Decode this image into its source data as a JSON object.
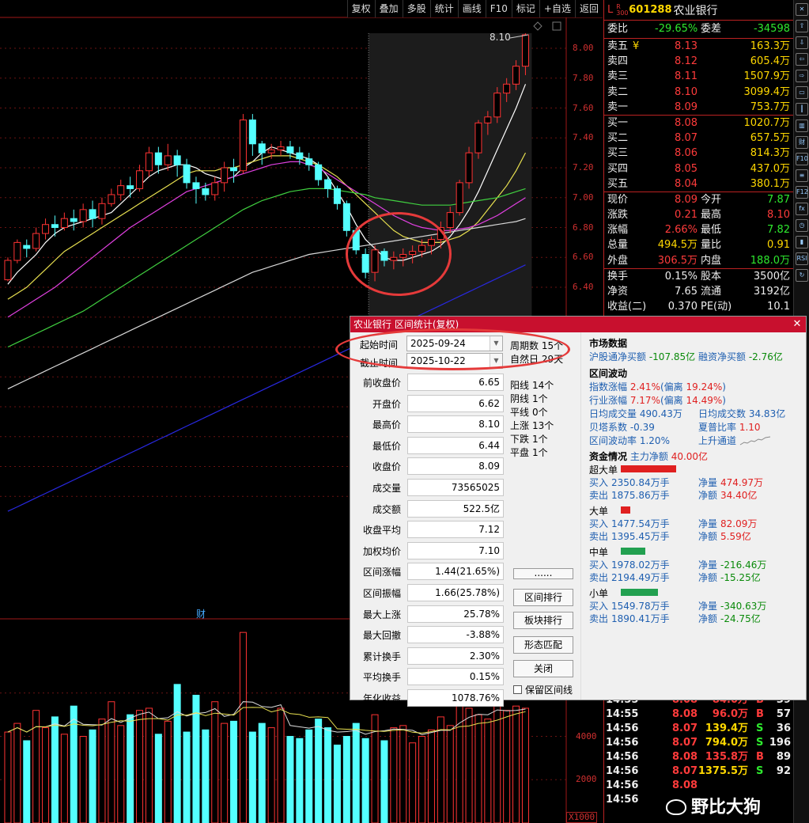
{
  "toolbar": [
    "复权",
    "叠加",
    "多股",
    "统计",
    "画线",
    "F10",
    "标记",
    "+自选",
    "返回"
  ],
  "chart": {
    "price_axis": [
      "8.00",
      "7.80",
      "7.60",
      "7.40",
      "7.20",
      "7.00",
      "6.80",
      "6.60",
      "6.40"
    ],
    "vol_axis": [
      "6000",
      "4000",
      "2000"
    ],
    "vol_unit": "X1000",
    "peak_label": "8.10",
    "fin_marker": "财"
  },
  "chart_data": {
    "type": "candlestick",
    "ylim": [
      6.3,
      8.2
    ],
    "candles": [
      [
        6.45,
        6.58,
        6.44,
        6.6
      ],
      [
        6.58,
        6.7,
        6.56,
        6.72
      ],
      [
        6.68,
        6.66,
        6.6,
        6.72
      ],
      [
        6.66,
        6.76,
        6.64,
        6.8
      ],
      [
        6.76,
        6.82,
        6.72,
        6.86
      ],
      [
        6.82,
        6.8,
        6.74,
        6.88
      ],
      [
        6.8,
        6.86,
        6.78,
        6.9
      ],
      [
        6.86,
        6.84,
        6.78,
        6.92
      ],
      [
        6.84,
        6.92,
        6.8,
        6.96
      ],
      [
        6.92,
        6.86,
        6.8,
        6.98
      ],
      [
        6.86,
        6.96,
        6.82,
        7.0
      ],
      [
        6.96,
        7.02,
        6.94,
        7.06
      ],
      [
        7.02,
        7.08,
        6.98,
        7.12
      ],
      [
        7.08,
        7.06,
        7.0,
        7.14
      ],
      [
        7.06,
        7.18,
        7.04,
        7.22
      ],
      [
        7.18,
        7.3,
        7.14,
        7.34
      ],
      [
        7.3,
        7.22,
        7.16,
        7.34
      ],
      [
        7.22,
        7.28,
        7.18,
        7.36
      ],
      [
        7.28,
        7.22,
        7.14,
        7.32
      ],
      [
        7.22,
        7.1,
        7.06,
        7.26
      ],
      [
        7.1,
        7.06,
        6.96,
        7.14
      ],
      [
        7.06,
        7.02,
        6.98,
        7.1
      ],
      [
        7.02,
        7.1,
        6.98,
        7.14
      ],
      [
        7.1,
        7.2,
        7.04,
        7.24
      ],
      [
        7.2,
        7.18,
        7.1,
        7.26
      ],
      [
        7.18,
        7.52,
        7.16,
        7.56
      ],
      [
        7.52,
        7.36,
        7.28,
        7.56
      ],
      [
        7.36,
        7.3,
        7.22,
        7.38
      ],
      [
        7.3,
        7.32,
        7.26,
        7.36
      ],
      [
        7.32,
        7.34,
        7.28,
        7.38
      ],
      [
        7.34,
        7.3,
        7.26,
        7.38
      ],
      [
        7.3,
        7.26,
        7.22,
        7.34
      ],
      [
        7.26,
        7.22,
        7.18,
        7.3
      ],
      [
        7.22,
        7.12,
        7.08,
        7.24
      ],
      [
        7.12,
        7.06,
        7.0,
        7.14
      ],
      [
        7.06,
        6.96,
        6.92,
        7.08
      ],
      [
        6.96,
        6.78,
        6.74,
        6.98
      ],
      [
        6.78,
        6.65,
        6.62,
        6.8
      ],
      [
        6.62,
        6.5,
        6.46,
        6.66
      ],
      [
        6.5,
        6.65,
        6.44,
        6.68
      ],
      [
        6.64,
        6.58,
        6.54,
        6.66
      ],
      [
        6.58,
        6.6,
        6.52,
        6.64
      ],
      [
        6.6,
        6.62,
        6.54,
        6.66
      ],
      [
        6.62,
        6.64,
        6.56,
        6.68
      ],
      [
        6.64,
        6.68,
        6.6,
        6.72
      ],
      [
        6.68,
        6.72,
        6.62,
        6.74
      ],
      [
        6.72,
        6.8,
        6.66,
        6.84
      ],
      [
        6.8,
        6.9,
        6.76,
        6.94
      ],
      [
        6.9,
        7.1,
        6.88,
        7.12
      ],
      [
        7.1,
        7.3,
        7.06,
        7.34
      ],
      [
        7.3,
        7.5,
        7.26,
        7.52
      ],
      [
        7.5,
        7.54,
        7.42,
        7.58
      ],
      [
        7.54,
        7.7,
        7.5,
        7.74
      ],
      [
        7.7,
        7.76,
        7.64,
        7.8
      ],
      [
        7.76,
        7.88,
        7.72,
        7.92
      ],
      [
        7.88,
        8.09,
        7.82,
        8.1
      ]
    ],
    "ma": [
      {
        "color": "#ffffff",
        "values": [
          6.42,
          6.5,
          6.56,
          6.62,
          6.7,
          6.76,
          6.8,
          6.82,
          6.84,
          6.86,
          6.88,
          6.9,
          6.96,
          7.02,
          7.08,
          7.14,
          7.18,
          7.2,
          7.22,
          7.22,
          7.2,
          7.16,
          7.14,
          7.12,
          7.14,
          7.2,
          7.24,
          7.3,
          7.34,
          7.32,
          7.3,
          7.28,
          7.26,
          7.22,
          7.14,
          7.04,
          6.94,
          6.82,
          6.72,
          6.66,
          6.6,
          6.58,
          6.58,
          6.6,
          6.62,
          6.64,
          6.68,
          6.74,
          6.82,
          6.92,
          7.04,
          7.18,
          7.32,
          7.46,
          7.6,
          7.76
        ]
      },
      {
        "color": "#e8e050",
        "values": [
          6.32,
          6.36,
          6.4,
          6.46,
          6.52,
          6.58,
          6.64,
          6.68,
          6.72,
          6.76,
          6.8,
          6.84,
          6.88,
          6.92,
          6.96,
          7.0,
          7.04,
          7.08,
          7.12,
          7.16,
          7.18,
          7.18,
          7.18,
          7.2,
          7.2,
          7.22,
          7.24,
          7.26,
          7.28,
          7.28,
          7.28,
          7.26,
          7.24,
          7.22,
          7.18,
          7.14,
          7.08,
          7.02,
          6.96,
          6.9,
          6.84,
          6.78,
          6.74,
          6.72,
          6.7,
          6.7,
          6.7,
          6.72,
          6.74,
          6.78,
          6.84,
          6.92,
          7.0,
          7.08,
          7.18,
          7.3
        ]
      },
      {
        "color": "#e040e0",
        "values": [
          6.2,
          6.24,
          6.28,
          6.32,
          6.36,
          6.4,
          6.45,
          6.5,
          6.55,
          6.6,
          6.65,
          6.7,
          6.75,
          6.8,
          6.84,
          6.88,
          6.92,
          6.96,
          7.0,
          7.04,
          7.06,
          7.08,
          7.1,
          7.12,
          7.14,
          7.16,
          7.18,
          7.2,
          7.22,
          7.23,
          7.24,
          7.24,
          7.22,
          7.2,
          7.16,
          7.12,
          7.08,
          7.04,
          7.0,
          6.96,
          6.92,
          6.88,
          6.85,
          6.82,
          6.8,
          6.79,
          6.78,
          6.78,
          6.79,
          6.8,
          6.82,
          6.85,
          6.88,
          6.92,
          6.96,
          7.0
        ]
      },
      {
        "color": "#40d040",
        "values": [
          6.0,
          6.03,
          6.06,
          6.09,
          6.12,
          6.15,
          6.18,
          6.21,
          6.24,
          6.28,
          6.32,
          6.36,
          6.4,
          6.44,
          6.48,
          6.52,
          6.56,
          6.6,
          6.64,
          6.68,
          6.72,
          6.76,
          6.8,
          6.84,
          6.88,
          6.92,
          6.95,
          6.98,
          7.0,
          7.02,
          7.04,
          7.05,
          7.06,
          7.06,
          7.06,
          7.05,
          7.04,
          7.03,
          7.02,
          7.0,
          6.99,
          6.98,
          6.97,
          6.96,
          6.95,
          6.95,
          6.95,
          6.95,
          6.96,
          6.97,
          6.98,
          6.99,
          7.0,
          7.02,
          7.04,
          7.06
        ]
      },
      {
        "color": "#d8d8d8",
        "values": [
          5.72,
          5.75,
          5.78,
          5.81,
          5.84,
          5.87,
          5.9,
          5.93,
          5.96,
          5.99,
          6.02,
          6.05,
          6.08,
          6.11,
          6.14,
          6.17,
          6.2,
          6.23,
          6.26,
          6.29,
          6.32,
          6.35,
          6.38,
          6.41,
          6.44,
          6.47,
          6.5,
          6.52,
          6.54,
          6.56,
          6.58,
          6.6,
          6.62,
          6.63,
          6.64,
          6.65,
          6.66,
          6.67,
          6.68,
          6.69,
          6.7,
          6.71,
          6.72,
          6.73,
          6.74,
          6.75,
          6.76,
          6.77,
          6.78,
          6.79,
          6.8,
          6.81,
          6.82,
          6.83,
          6.84,
          6.86
        ]
      },
      {
        "color": "#2828e0",
        "values": [
          4.9,
          4.93,
          4.96,
          4.99,
          5.02,
          5.05,
          5.08,
          5.11,
          5.14,
          5.17,
          5.2,
          5.23,
          5.26,
          5.29,
          5.32,
          5.35,
          5.38,
          5.41,
          5.44,
          5.47,
          5.5,
          5.53,
          5.56,
          5.59,
          5.62,
          5.65,
          5.68,
          5.71,
          5.74,
          5.77,
          5.8,
          5.83,
          5.86,
          5.89,
          5.92,
          5.95,
          5.98,
          6.01,
          6.04,
          6.07,
          6.1,
          6.13,
          6.16,
          6.19,
          6.22,
          6.25,
          6.28,
          6.31,
          6.34,
          6.37,
          6.4,
          6.43,
          6.46,
          6.49,
          6.52,
          6.55
        ]
      }
    ],
    "volume": [
      4200,
      4600,
      3800,
      5200,
      4400,
      4900,
      4100,
      5400,
      4000,
      4300,
      4800,
      5600,
      4500,
      5000,
      5200,
      5300,
      4100,
      4700,
      6400,
      4200,
      5900,
      4300,
      5600,
      4600,
      4700,
      8800,
      4200,
      4600,
      4400,
      5300,
      4000,
      3900,
      4300,
      4800,
      4400,
      3600,
      4000,
      4600,
      3900,
      5000,
      3800,
      4400,
      4500,
      3700,
      4000,
      4300,
      4900,
      4500,
      5400,
      5300,
      5000,
      4800,
      5600,
      5200,
      5400,
      5300
    ],
    "vol_ylim": [
      0,
      9500
    ]
  },
  "quote": {
    "header": {
      "L": "L",
      "R": "R\n300",
      "code": "601288",
      "name": "农业银行"
    },
    "weibi": {
      "label1": "委比",
      "v1": "-29.65%",
      "label2": "委差",
      "v2": "-34598"
    },
    "asks": [
      {
        "l": "卖五",
        "y": "¥",
        "p": "8.13",
        "v": "163.3万"
      },
      {
        "l": "卖四",
        "y": "",
        "p": "8.12",
        "v": "605.4万"
      },
      {
        "l": "卖三",
        "y": "",
        "p": "8.11",
        "v": "1507.9万"
      },
      {
        "l": "卖二",
        "y": "",
        "p": "8.10",
        "v": "3099.4万"
      },
      {
        "l": "卖一",
        "y": "",
        "p": "8.09",
        "v": "753.7万"
      }
    ],
    "bids": [
      {
        "l": "买一",
        "p": "8.08",
        "v": "1020.7万"
      },
      {
        "l": "买二",
        "p": "8.07",
        "v": "657.5万"
      },
      {
        "l": "买三",
        "p": "8.06",
        "v": "814.3万"
      },
      {
        "l": "买四",
        "p": "8.05",
        "v": "437.0万"
      },
      {
        "l": "买五",
        "p": "8.04",
        "v": "380.1万"
      }
    ],
    "stats": [
      {
        "l1": "现价",
        "v1": "8.09",
        "c1": "red",
        "l2": "今开",
        "v2": "7.87",
        "c2": "green"
      },
      {
        "l1": "涨跌",
        "v1": "0.21",
        "c1": "red",
        "l2": "最高",
        "v2": "8.10",
        "c2": "red"
      },
      {
        "l1": "涨幅",
        "v1": "2.66%",
        "c1": "red",
        "l2": "最低",
        "v2": "7.82",
        "c2": "green"
      },
      {
        "l1": "总量",
        "v1": "494.5万",
        "c1": "yel",
        "l2": "量比",
        "v2": "0.91",
        "c2": "yel"
      },
      {
        "l1": "外盘",
        "v1": "306.5万",
        "c1": "red",
        "l2": "内盘",
        "v2": "188.0万",
        "c2": "green"
      }
    ],
    "stats2": [
      {
        "l1": "换手",
        "v1": "0.15%",
        "l2": "股本",
        "v2": "3500亿"
      },
      {
        "l1": "净资",
        "v1": "7.65",
        "l2": "流通",
        "v2": "3192亿"
      },
      {
        "l1": "收益(二)",
        "v1": "0.370",
        "l2": "PE(动)",
        "v2": "10.1"
      }
    ],
    "ticks": [
      {
        "t": "14:55",
        "p": "8.08",
        "v": "84.0万",
        "d": "B",
        "n": "39"
      },
      {
        "t": "14:55",
        "p": "8.08",
        "v": "96.0万",
        "d": "B",
        "n": "57"
      },
      {
        "t": "14:56",
        "p": "8.07",
        "v": "139.4万",
        "d": "S",
        "n": "36"
      },
      {
        "t": "14:56",
        "p": "8.07",
        "v": "794.0万",
        "d": "S",
        "n": "196"
      },
      {
        "t": "14:56",
        "p": "8.08",
        "v": "135.8万",
        "d": "B",
        "n": "89"
      },
      {
        "t": "14:56",
        "p": "8.07",
        "v": "1375.5万",
        "d": "S",
        "n": "92"
      },
      {
        "t": "14:56",
        "p": "8.08",
        "v": "",
        "d": "",
        "n": ""
      },
      {
        "t": "14:56",
        "p": "",
        "v": "",
        "d": "",
        "n": ""
      }
    ]
  },
  "dialog": {
    "title": "农业银行 区间统计(复权)",
    "start_label": "起始时间",
    "start_value": "2025-09-24",
    "end_label": "截止时间",
    "end_value": "2025-10-22",
    "period_label": "周期数",
    "period_value": "15个",
    "natural_label": "自然日",
    "natural_value": "29天",
    "fields": [
      {
        "l": "前收盘价",
        "v": "6.65"
      },
      {
        "l": "开盘价",
        "v": "6.62"
      },
      {
        "l": "最高价",
        "v": "8.10"
      },
      {
        "l": "最低价",
        "v": "6.44"
      },
      {
        "l": "收盘价",
        "v": "8.09"
      },
      {
        "l": "成交量",
        "v": "73565025"
      },
      {
        "l": "成交额",
        "v": "522.5亿"
      },
      {
        "l": "收盘平均",
        "v": "7.12"
      },
      {
        "l": "加权均价",
        "v": "7.10"
      },
      {
        "l": "区间涨幅",
        "v": "1.44(21.65%)"
      },
      {
        "l": "区间振幅",
        "v": "1.66(25.78%)"
      },
      {
        "l": "最大上涨",
        "v": "25.78%"
      },
      {
        "l": "最大回撤",
        "v": "-3.88%"
      },
      {
        "l": "累计换手",
        "v": "2.30%"
      },
      {
        "l": "平均换手",
        "v": "0.15%"
      },
      {
        "l": "年化收益",
        "v": "1078.76%"
      }
    ],
    "counts": [
      {
        "l": "阳线",
        "v": "14个"
      },
      {
        "l": "阴线",
        "v": "1个"
      },
      {
        "l": "平线",
        "v": "0个"
      },
      {
        "l": "上涨",
        "v": "13个"
      },
      {
        "l": "下跌",
        "v": "1个"
      },
      {
        "l": "平盘",
        "v": "1个"
      }
    ],
    "buttons": [
      "......",
      "区间排行",
      "板块排行",
      "形态匹配",
      "关闭"
    ],
    "keep_label": "保留区间线",
    "market": {
      "title": "市场数据",
      "hg_l": "沪股通净买额",
      "hg_v": "-107.85亿",
      "rz_l": "融资净买额",
      "rz_v": "-2.76亿"
    },
    "volatility": {
      "title": "区间波动",
      "idx_l": "指数涨幅",
      "idx_v": "2.41%",
      "idx_dev_l": "(偏离",
      "idx_dev": "19.24%",
      "idx_close": ")",
      "ind_l": "行业涨幅",
      "ind_v": "7.17%",
      "ind_dev_l": "(偏离",
      "ind_dev": "14.49%",
      "ind_close": ")",
      "avgvol_l": "日均成交量",
      "avgvol_v": "490.43万",
      "avgamt_l": "日均成交数",
      "avgamt_v": "34.83亿",
      "beta_l": "贝塔系数",
      "beta_v": "-0.39",
      "sharpe_l": "夏普比率",
      "sharpe_v": "1.10",
      "volr_l": "区间波动率",
      "volr_v": "1.20%",
      "channel": "上升通道"
    },
    "funds": {
      "title": "资金情况",
      "main_l": "主力净额",
      "main_v": "40.00亿",
      "groups": [
        {
          "name": "超大单",
          "buy_l": "买入",
          "buy": "2350.84万手",
          "sell_l": "卖出",
          "sell": "1875.86万手",
          "nq_l": "净量",
          "nq": "474.97万",
          "ne_l": "净额",
          "ne": "34.40亿",
          "color": "#e02020",
          "level": 0.9,
          "nqc": "dr",
          "nec": "dr"
        },
        {
          "name": "大单",
          "buy_l": "买入",
          "buy": "1477.54万手",
          "sell_l": "卖出",
          "sell": "1395.45万手",
          "nq_l": "净量",
          "nq": "82.09万",
          "ne_l": "净额",
          "ne": "5.59亿",
          "color": "#e02020",
          "level": 0.15,
          "nqc": "dr",
          "nec": "dr"
        },
        {
          "name": "中单",
          "buy_l": "买入",
          "buy": "1978.02万手",
          "sell_l": "卖出",
          "sell": "2194.49万手",
          "nq_l": "净量",
          "nq": "-216.46万",
          "ne_l": "净额",
          "ne": "-15.25亿",
          "color": "#22a050",
          "level": 0.4,
          "nqc": "dg",
          "nec": "dg"
        },
        {
          "name": "小单",
          "buy_l": "买入",
          "buy": "1549.78万手",
          "sell_l": "卖出",
          "sell": "1890.41万手",
          "nq_l": "净量",
          "nq": "-340.63万",
          "ne_l": "净额",
          "ne": "-24.75亿",
          "color": "#22a050",
          "level": 0.6,
          "nqc": "dg",
          "nec": "dg"
        }
      ]
    }
  },
  "watermark": "野比大狗"
}
